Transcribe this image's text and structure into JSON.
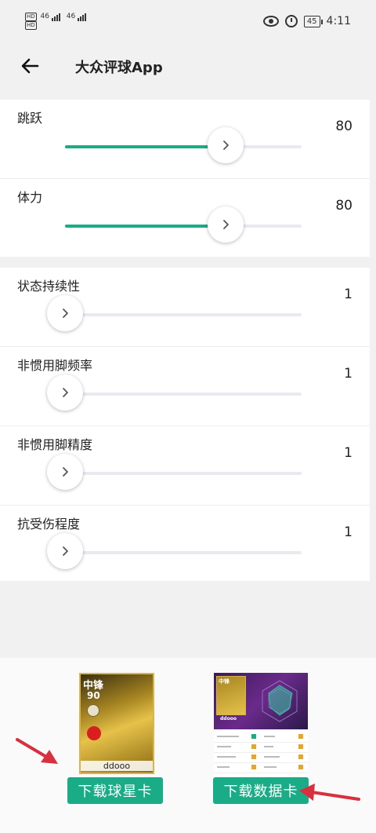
{
  "status_bar": {
    "network1": "HD",
    "network2": "HD",
    "sig1": "46",
    "sig2": "46",
    "battery": "45",
    "time": "4:11"
  },
  "appbar": {
    "title": "大众评球App"
  },
  "sliders_group1": [
    {
      "label": "跳跃",
      "value": "80",
      "fraction": 0.68
    },
    {
      "label": "体力",
      "value": "80",
      "fraction": 0.68
    }
  ],
  "sliders_group2": [
    {
      "label": "状态持续性",
      "value": "1",
      "fraction": 0.0
    },
    {
      "label": "非惯用脚频率",
      "value": "1",
      "fraction": 0.0
    },
    {
      "label": "非惯用脚精度",
      "value": "1",
      "fraction": 0.0
    },
    {
      "label": "抗受伤程度",
      "value": "1",
      "fraction": 0.0
    }
  ],
  "star_card": {
    "position": "中锋",
    "rating": "90",
    "name": "ddooo",
    "button": "下载球星卡"
  },
  "data_card": {
    "position": "中锋",
    "player": "ddooo",
    "button": "下载数据卡"
  },
  "colors": {
    "accent": "#1aac86",
    "arrow": "#d9303f"
  }
}
